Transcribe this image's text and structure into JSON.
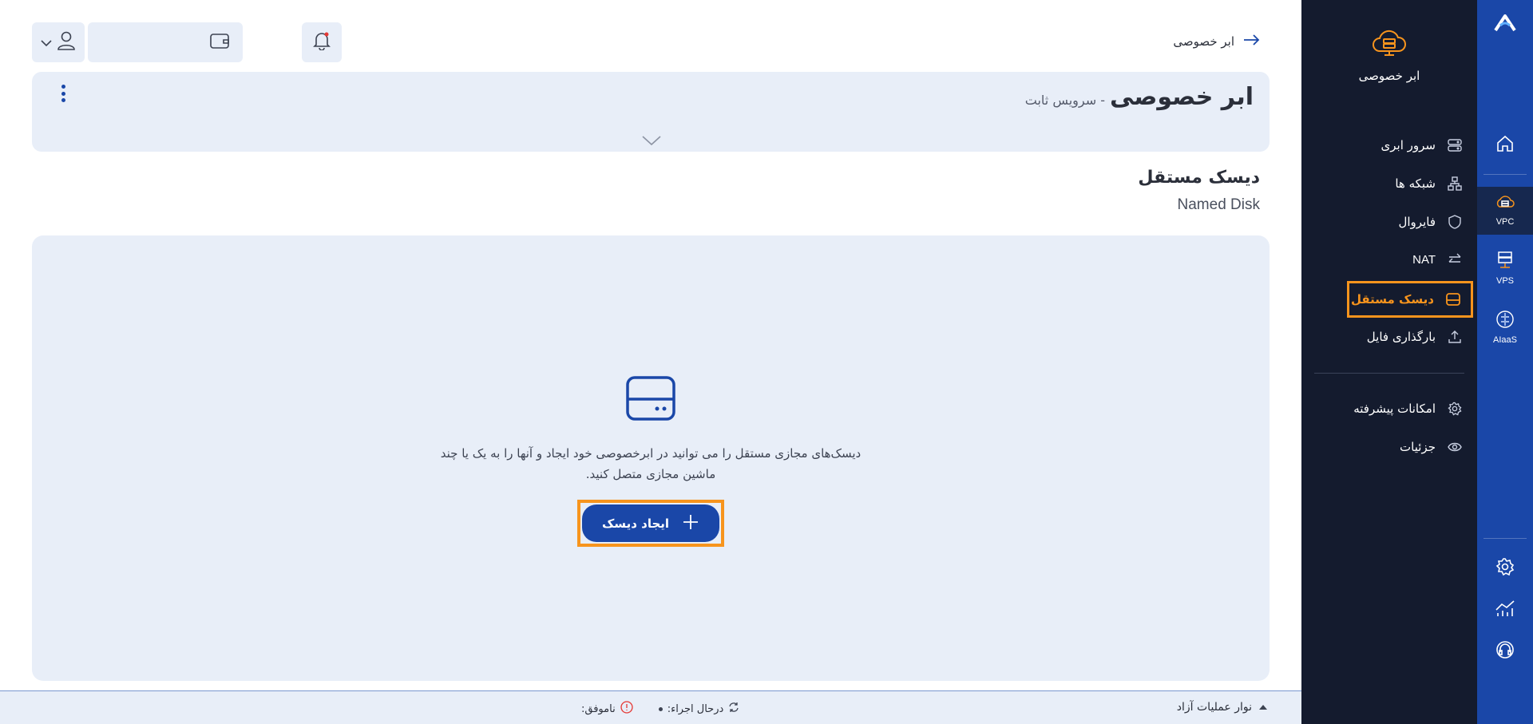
{
  "rail": {
    "items": [
      {
        "icon": "home-icon",
        "label": ""
      },
      {
        "icon": "vpc-icon",
        "label": "VPC"
      },
      {
        "icon": "vps-icon",
        "label": "VPS"
      },
      {
        "icon": "aiaas-icon",
        "label": "AIaaS"
      },
      {
        "icon": "settings-icon",
        "label": ""
      },
      {
        "icon": "chart-icon",
        "label": ""
      },
      {
        "icon": "support-icon",
        "label": ""
      }
    ]
  },
  "sidebar": {
    "title": "ابر خصوصی",
    "items": [
      {
        "label": "سرور ابری",
        "icon": "server-icon"
      },
      {
        "label": "شبکه ها",
        "icon": "network-icon"
      },
      {
        "label": "فایروال",
        "icon": "shield-icon"
      },
      {
        "label": "NAT",
        "icon": "arrows-icon"
      },
      {
        "label": "دیسک مستقل",
        "icon": "disk-icon",
        "active": true
      },
      {
        "label": "بارگذاری فایل",
        "icon": "upload-icon"
      },
      {
        "label": "امکانات پیشرفته",
        "icon": "gear-icon"
      },
      {
        "label": "جزئیات",
        "icon": "eye-icon"
      }
    ]
  },
  "header": {
    "back_label": "ابر خصوصی"
  },
  "service": {
    "title": "ابر خصوصی",
    "subtitle": "- سرویس ثابت"
  },
  "section": {
    "title": "دیسک مستقل",
    "subtitle": "Named Disk"
  },
  "empty_state": {
    "text": "دیسک‌های مجازی مستقل را می توانید در ابرخصوصی خود ایجاد و آنها را به یک یا چند ماشین مجازی متصل کنید.",
    "button_label": "ایجاد دیسک"
  },
  "opsbar": {
    "title": "نوار عملیات آزاد",
    "running_label": "درحال اجراء:",
    "failed_label": "ناموفق:"
  },
  "colors": {
    "rail": "#1a47a8",
    "sidebar": "#141b2e",
    "accent": "#f7941d",
    "panel": "#e8eef8",
    "button": "#1a47a8"
  }
}
